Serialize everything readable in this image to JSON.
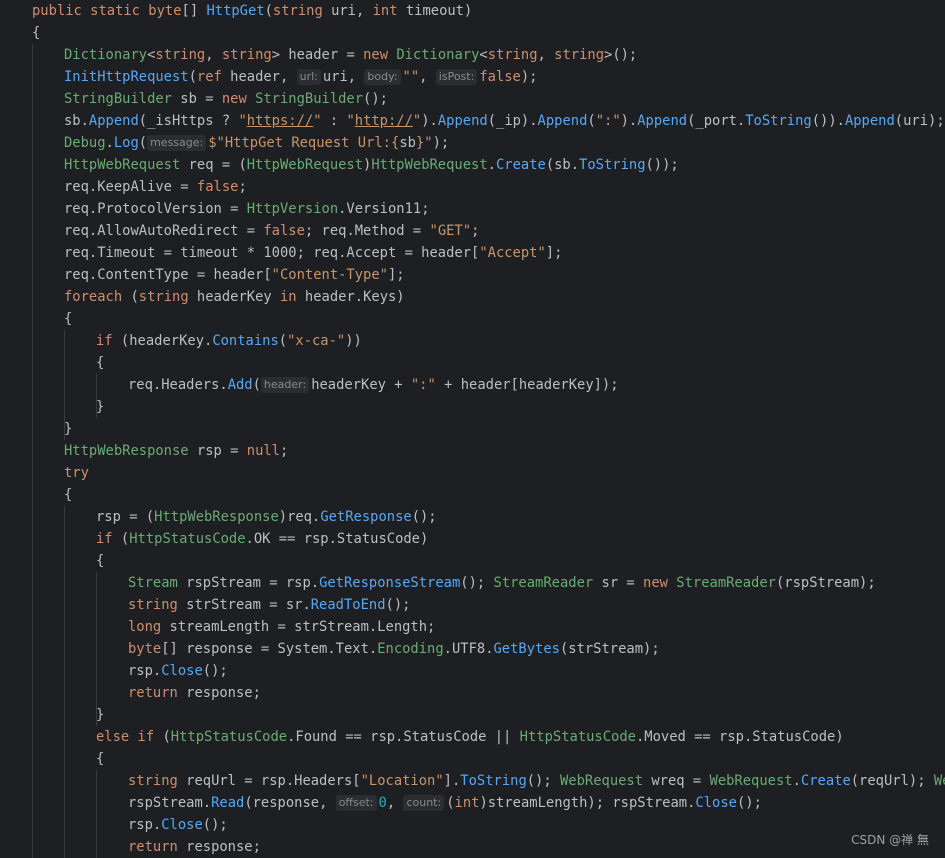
{
  "editor": {
    "language": "C#",
    "watermark": "CSDN @禅 無",
    "lines": [
      [
        [
          "k",
          "public static "
        ],
        [
          "k",
          "byte"
        ],
        [
          "p",
          "[] "
        ],
        [
          "m",
          "HttpGet"
        ],
        [
          "p",
          "("
        ],
        [
          "k",
          "string"
        ],
        [
          "p",
          " uri, "
        ],
        [
          "k",
          "int"
        ],
        [
          "p",
          " timeout)"
        ]
      ],
      [
        [
          "p",
          "{"
        ]
      ],
      [
        [
          "t",
          "Dictionary"
        ],
        [
          "p",
          "<"
        ],
        [
          "k",
          "string"
        ],
        [
          "p",
          ", "
        ],
        [
          "k",
          "string"
        ],
        [
          "p",
          "> header = "
        ],
        [
          "k",
          "new "
        ],
        [
          "t",
          "Dictionary"
        ],
        [
          "p",
          "<"
        ],
        [
          "k",
          "string"
        ],
        [
          "p",
          ", "
        ],
        [
          "k",
          "string"
        ],
        [
          "p",
          ">();"
        ]
      ],
      [
        [
          "m",
          "InitHttpRequest"
        ],
        [
          "p",
          "("
        ],
        [
          "k",
          "ref"
        ],
        [
          "p",
          " header, "
        ],
        [
          "h",
          "url:"
        ],
        [
          "p",
          "uri, "
        ],
        [
          "h",
          "body:"
        ],
        [
          "s",
          "\"\""
        ],
        [
          "p",
          ", "
        ],
        [
          "h",
          "isPost:"
        ],
        [
          "k",
          "false"
        ],
        [
          "p",
          ");"
        ]
      ],
      [
        [
          "t",
          "StringBuilder"
        ],
        [
          "p",
          " sb = "
        ],
        [
          "k",
          "new "
        ],
        [
          "t",
          "StringBuilder"
        ],
        [
          "p",
          "();"
        ]
      ],
      [
        [
          "p",
          "sb."
        ],
        [
          "m",
          "Append"
        ],
        [
          "p",
          "(_isHttps ? "
        ],
        [
          "s",
          "\""
        ],
        [
          "su",
          "https://"
        ],
        [
          "s",
          "\""
        ],
        [
          "p",
          " : "
        ],
        [
          "s",
          "\""
        ],
        [
          "su",
          "http://"
        ],
        [
          "s",
          "\""
        ],
        [
          "p",
          ")."
        ],
        [
          "m",
          "Append"
        ],
        [
          "p",
          "(_ip)."
        ],
        [
          "m",
          "Append"
        ],
        [
          "p",
          "("
        ],
        [
          "s",
          "\":\""
        ],
        [
          "p",
          ")."
        ],
        [
          "m",
          "Append"
        ],
        [
          "p",
          "(_port."
        ],
        [
          "m",
          "ToString"
        ],
        [
          "p",
          "())."
        ],
        [
          "m",
          "Append"
        ],
        [
          "p",
          "(uri);"
        ]
      ],
      [
        [
          "t",
          "Debug"
        ],
        [
          "p",
          "."
        ],
        [
          "m",
          "Log"
        ],
        [
          "p",
          "("
        ],
        [
          "h",
          "message:"
        ],
        [
          "s",
          "$\"HttpGet Request Url:{"
        ],
        [
          "p",
          "sb"
        ],
        [
          "s",
          "}\""
        ],
        [
          "p",
          ");"
        ]
      ],
      [
        [
          "t",
          "HttpWebRequest"
        ],
        [
          "p",
          " req = ("
        ],
        [
          "t",
          "HttpWebRequest"
        ],
        [
          "p",
          ")"
        ],
        [
          "t",
          "HttpWebRequest"
        ],
        [
          "p",
          "."
        ],
        [
          "m",
          "Create"
        ],
        [
          "p",
          "(sb."
        ],
        [
          "m",
          "ToString"
        ],
        [
          "p",
          "());"
        ]
      ],
      [
        [
          "p",
          "req.KeepAlive = "
        ],
        [
          "k",
          "false"
        ],
        [
          "p",
          ";"
        ]
      ],
      [
        [
          "p",
          "req.ProtocolVersion = "
        ],
        [
          "t",
          "HttpVersion"
        ],
        [
          "p",
          ".Version11;"
        ]
      ],
      [
        [
          "p",
          "req.AllowAutoRedirect = "
        ],
        [
          "k",
          "false"
        ],
        [
          "p",
          "; req.Method = "
        ],
        [
          "s",
          "\"GET\""
        ],
        [
          "p",
          ";"
        ]
      ],
      [
        [
          "p",
          "req.Timeout = timeout * 1000; req.Accept = header["
        ],
        [
          "s",
          "\"Accept\""
        ],
        [
          "p",
          "];"
        ]
      ],
      [
        [
          "p",
          "req.ContentType = header["
        ],
        [
          "s",
          "\"Content-Type\""
        ],
        [
          "p",
          "];"
        ]
      ],
      [
        [
          "k",
          "foreach"
        ],
        [
          "p",
          " ("
        ],
        [
          "k",
          "string"
        ],
        [
          "p",
          " headerKey "
        ],
        [
          "k",
          "in"
        ],
        [
          "p",
          " header.Keys)"
        ]
      ],
      [
        [
          "p",
          "{"
        ]
      ],
      [
        [
          "k",
          "if"
        ],
        [
          "p",
          " (headerKey."
        ],
        [
          "m",
          "Contains"
        ],
        [
          "p",
          "("
        ],
        [
          "s",
          "\"x-ca-\""
        ],
        [
          "p",
          "))"
        ]
      ],
      [
        [
          "p",
          "{"
        ]
      ],
      [
        [
          "p",
          "req.Headers."
        ],
        [
          "m",
          "Add"
        ],
        [
          "p",
          "("
        ],
        [
          "h",
          "header:"
        ],
        [
          "p",
          "headerKey + "
        ],
        [
          "s",
          "\":\""
        ],
        [
          "p",
          " + header[headerKey]);"
        ]
      ],
      [
        [
          "p",
          "}"
        ]
      ],
      [
        [
          "p",
          "}"
        ]
      ],
      [
        [
          "t",
          "HttpWebResponse"
        ],
        [
          "p",
          " rsp = "
        ],
        [
          "k",
          "null"
        ],
        [
          "p",
          ";"
        ]
      ],
      [
        [
          "k",
          "try"
        ]
      ],
      [
        [
          "p",
          "{"
        ]
      ],
      [
        [
          "p",
          "rsp = ("
        ],
        [
          "t",
          "HttpWebResponse"
        ],
        [
          "p",
          ")req."
        ],
        [
          "m",
          "GetResponse"
        ],
        [
          "p",
          "();"
        ]
      ],
      [
        [
          "k",
          "if"
        ],
        [
          "p",
          " ("
        ],
        [
          "t",
          "HttpStatusCode"
        ],
        [
          "p",
          ".OK == rsp.StatusCode)"
        ]
      ],
      [
        [
          "p",
          "{"
        ]
      ],
      [
        [
          "t",
          "Stream"
        ],
        [
          "p",
          " rspStream = rsp."
        ],
        [
          "m",
          "GetResponseStream"
        ],
        [
          "p",
          "(); "
        ],
        [
          "t",
          "StreamReader"
        ],
        [
          "p",
          " sr = "
        ],
        [
          "k",
          "new "
        ],
        [
          "t",
          "StreamReader"
        ],
        [
          "p",
          "(rspStream);"
        ]
      ],
      [
        [
          "k",
          "string"
        ],
        [
          "p",
          " strStream = sr."
        ],
        [
          "m",
          "ReadToEnd"
        ],
        [
          "p",
          "();"
        ]
      ],
      [
        [
          "k",
          "long"
        ],
        [
          "p",
          " streamLength = strStream.Length;"
        ]
      ],
      [
        [
          "k",
          "byte"
        ],
        [
          "p",
          "[] response = System.Text."
        ],
        [
          "t",
          "Encoding"
        ],
        [
          "p",
          ".UTF8."
        ],
        [
          "m",
          "GetBytes"
        ],
        [
          "p",
          "(strStream);"
        ]
      ],
      [
        [
          "p",
          "rsp."
        ],
        [
          "m",
          "Close"
        ],
        [
          "p",
          "();"
        ]
      ],
      [
        [
          "k",
          "return"
        ],
        [
          "p",
          " response;"
        ]
      ],
      [
        [
          "p",
          "}"
        ]
      ],
      [
        [
          "k",
          "else if"
        ],
        [
          "p",
          " ("
        ],
        [
          "t",
          "HttpStatusCode"
        ],
        [
          "p",
          ".Found == rsp.StatusCode || "
        ],
        [
          "t",
          "HttpStatusCode"
        ],
        [
          "p",
          ".Moved == rsp.StatusCode)"
        ]
      ],
      [
        [
          "p",
          "{"
        ]
      ],
      [
        [
          "k",
          "string"
        ],
        [
          "p",
          " reqUrl = rsp.Headers["
        ],
        [
          "s",
          "\"Location\""
        ],
        [
          "p",
          "]."
        ],
        [
          "m",
          "ToString"
        ],
        [
          "p",
          "(); "
        ],
        [
          "t",
          "WebRequest"
        ],
        [
          "p",
          " wreq = "
        ],
        [
          "t",
          "WebRequest"
        ],
        [
          "p",
          "."
        ],
        [
          "m",
          "Create"
        ],
        [
          "p",
          "(reqUrl); "
        ],
        [
          "t",
          "WebRe"
        ]
      ],
      [
        [
          "p",
          "rspStream."
        ],
        [
          "m",
          "Read"
        ],
        [
          "p",
          "(response, "
        ],
        [
          "h",
          "offset:"
        ],
        [
          "n",
          "0"
        ],
        [
          "p",
          ", "
        ],
        [
          "h",
          "count:"
        ],
        [
          "p",
          "("
        ],
        [
          "k",
          "int"
        ],
        [
          "p",
          ")streamLength); rspStream."
        ],
        [
          "m",
          "Close"
        ],
        [
          "p",
          "();"
        ]
      ],
      [
        [
          "p",
          "rsp."
        ],
        [
          "m",
          "Close"
        ],
        [
          "p",
          "();"
        ]
      ],
      [
        [
          "k",
          "return"
        ],
        [
          "p",
          " response;"
        ]
      ]
    ],
    "indents": [
      0,
      0,
      1,
      1,
      1,
      1,
      1,
      1,
      1,
      1,
      1,
      1,
      1,
      1,
      1,
      2,
      2,
      3,
      2,
      1,
      1,
      1,
      1,
      2,
      2,
      2,
      3,
      3,
      3,
      3,
      3,
      3,
      2,
      2,
      2,
      3,
      3,
      3,
      3
    ],
    "colors": {
      "background": "#1e1f22",
      "keyword": "#cf8e6d",
      "type": "#6aab73",
      "string": "#c7956a",
      "method": "#56a8f5",
      "number": "#2aacb8",
      "hint_bg": "#2b2d30"
    }
  }
}
